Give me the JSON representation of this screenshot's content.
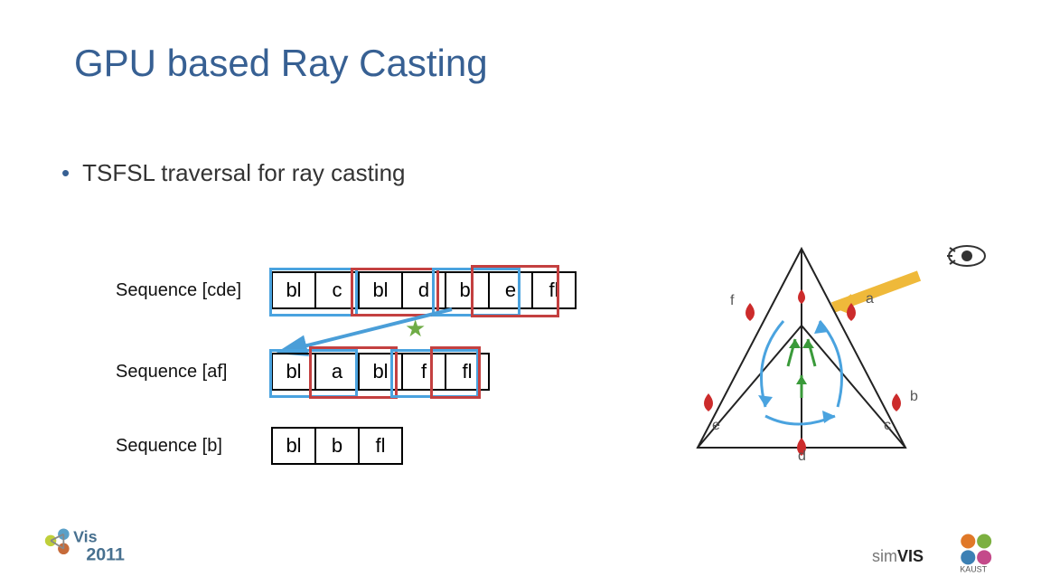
{
  "title": "GPU based Ray Casting",
  "bullet": "TSFSL traversal for ray casting",
  "sequences": [
    {
      "label": "Sequence [cde]",
      "cells": [
        "bl",
        "c",
        "bl",
        "d",
        "bl",
        "e",
        "fl"
      ]
    },
    {
      "label": "Sequence [af]",
      "cells": [
        "bl",
        "a",
        "bl",
        "f",
        "fl"
      ]
    },
    {
      "label": "Sequence [b]",
      "cells": [
        "bl",
        "b",
        "fl"
      ]
    }
  ],
  "diagram_labels": {
    "a": "a",
    "b": "b",
    "c": "c",
    "d": "d",
    "e": "e",
    "f": "f"
  },
  "logos": {
    "vis": "Vis 2011",
    "simvis": "simVIS",
    "kaust": "KAUST"
  }
}
